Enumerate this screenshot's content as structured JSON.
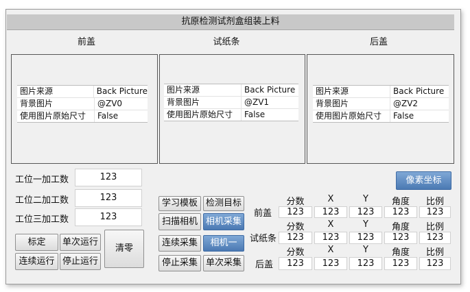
{
  "window": {
    "title": "抗原检测试剂盒组装上料"
  },
  "sections": [
    {
      "label": "前盖",
      "props": [
        [
          "图片来源",
          "Back Picture"
        ],
        [
          "背景图片",
          "@ZV0"
        ],
        [
          "使用图片原始尺寸",
          "False"
        ]
      ]
    },
    {
      "label": "试纸条",
      "props": [
        [
          "图片来源",
          "Back Picture"
        ],
        [
          "背景图片",
          "@ZV1"
        ],
        [
          "使用图片原始尺寸",
          "False"
        ]
      ]
    },
    {
      "label": "后盖",
      "props": [
        [
          "图片来源",
          "Back Picture"
        ],
        [
          "背景图片",
          "@ZV2"
        ],
        [
          "使用图片原始尺寸",
          "False"
        ]
      ]
    }
  ],
  "counters": [
    {
      "label": "工位一加工数",
      "value": "123"
    },
    {
      "label": "工位二加工数",
      "value": "123"
    },
    {
      "label": "工位三加工数",
      "value": "123"
    }
  ],
  "left_buttons": {
    "calibrate": "标定",
    "single_run": "单次运行",
    "continuous_run": "连续运行",
    "stop_run": "停止运行",
    "clear": "清零"
  },
  "mid_buttons": {
    "learn_template": "学习模板",
    "detect_target": "检测目标",
    "scan_camera": "扫描相机",
    "camera_capture": "相机采集",
    "continuous_capture": "连续采集",
    "camera_one": "相机一",
    "stop_capture": "停止采集",
    "single_capture": "单次采集"
  },
  "pixel_coords_button": "像素坐标",
  "result_grid": {
    "columns": [
      "分数",
      "X",
      "Y",
      "角度",
      "比例"
    ],
    "rows": [
      {
        "name": "前盖",
        "values": [
          "123",
          "123",
          "123",
          "123",
          "123"
        ]
      },
      {
        "name": "试纸条",
        "values": [
          "123",
          "123",
          "123",
          "123",
          "123"
        ]
      },
      {
        "name": "后盖",
        "values": [
          "123",
          "123",
          "123",
          "123",
          "123"
        ]
      }
    ]
  }
}
